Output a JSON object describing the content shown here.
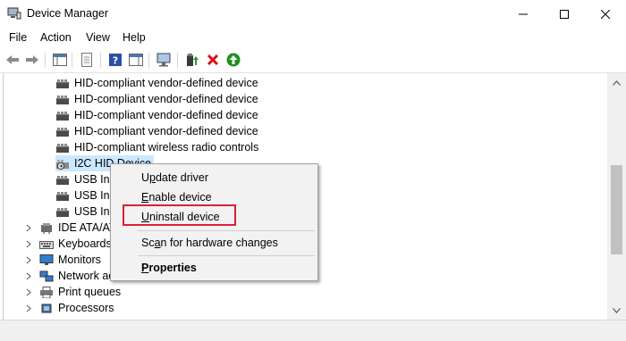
{
  "window": {
    "title": "Device Manager"
  },
  "menu": {
    "file": "File",
    "action": "Action",
    "view": "View",
    "help": "Help"
  },
  "tree": {
    "children": [
      {
        "label": "HID-compliant vendor-defined device"
      },
      {
        "label": "HID-compliant vendor-defined device"
      },
      {
        "label": "HID-compliant vendor-defined device"
      },
      {
        "label": "HID-compliant vendor-defined device"
      },
      {
        "label": "HID-compliant wireless radio controls"
      },
      {
        "label": "I2C HID Device"
      },
      {
        "label": "USB Inp"
      },
      {
        "label": "USB Inp"
      },
      {
        "label": "USB Inp"
      }
    ],
    "categories": [
      {
        "label": "IDE ATA/ATA"
      },
      {
        "label": "Keyboards"
      },
      {
        "label": "Monitors"
      },
      {
        "label": "Network ac"
      },
      {
        "label": "Print queues"
      },
      {
        "label": "Processors"
      }
    ]
  },
  "context_menu": {
    "update_pre": "U",
    "update_key": "p",
    "update_post": "date driver",
    "enable_key": "E",
    "enable_post": "nable device",
    "uninstall_key": "U",
    "uninstall_post": "ninstall device",
    "scan_pre": "Sc",
    "scan_key": "a",
    "scan_post": "n for hardware changes",
    "properties_key": "P",
    "properties_post": "roperties"
  },
  "colors": {
    "highlight_border": "#d9203a",
    "selected_bg": "#cce8ff"
  }
}
